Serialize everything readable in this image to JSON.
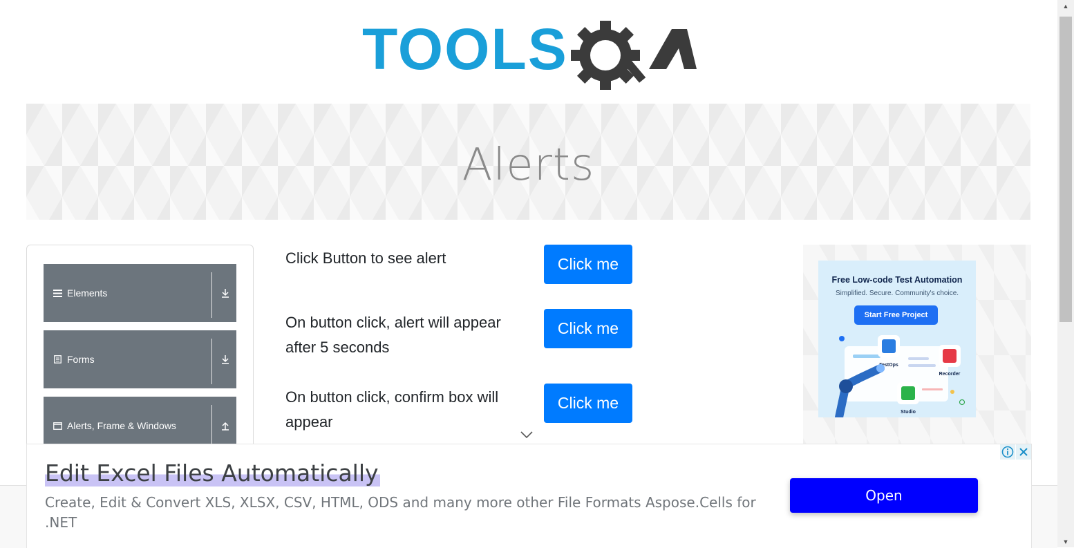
{
  "header": {
    "logo_text_part1": "TOOLS",
    "logo_text_part2": "QA",
    "logo_primary_color": "#1a9fd9",
    "logo_secondary_color": "#3b3b3b"
  },
  "banner": {
    "title": "Alerts"
  },
  "sidebar": {
    "groups": [
      {
        "label": "Elements",
        "icon": "hamburger-icon",
        "arrow": "download-arrow-icon"
      },
      {
        "label": "Forms",
        "icon": "document-icon",
        "arrow": "download-arrow-icon"
      },
      {
        "label": "Alerts, Frame & Windows",
        "icon": "window-icon",
        "arrow": "upload-arrow-icon"
      }
    ],
    "background_color": "#6c757d"
  },
  "main": {
    "rows": [
      {
        "text": "Click Button to see alert",
        "button_label": "Click me"
      },
      {
        "text": "On button click, alert will appear after 5 seconds",
        "button_label": "Click me"
      },
      {
        "text": "On button click, confirm box will appear",
        "button_label": "Click me"
      }
    ],
    "button_color": "#007bff"
  },
  "right_ad": {
    "title": "Free Low-code Test Automation",
    "subtitle": "Simplified. Secure. Community's choice.",
    "button_label": "Start Free Project",
    "products": [
      "TestOps",
      "Recorder",
      "Studio"
    ]
  },
  "bottom_ad": {
    "headline": "Edit Excel Files Automatically",
    "description": "Create, Edit & Convert XLS, XLSX, CSV, HTML, ODS and many more other File Formats Aspose.Cells for .NET",
    "button_label": "Open",
    "button_color": "#0000ff",
    "info_icon": "info-icon",
    "close_icon": "close-icon"
  }
}
